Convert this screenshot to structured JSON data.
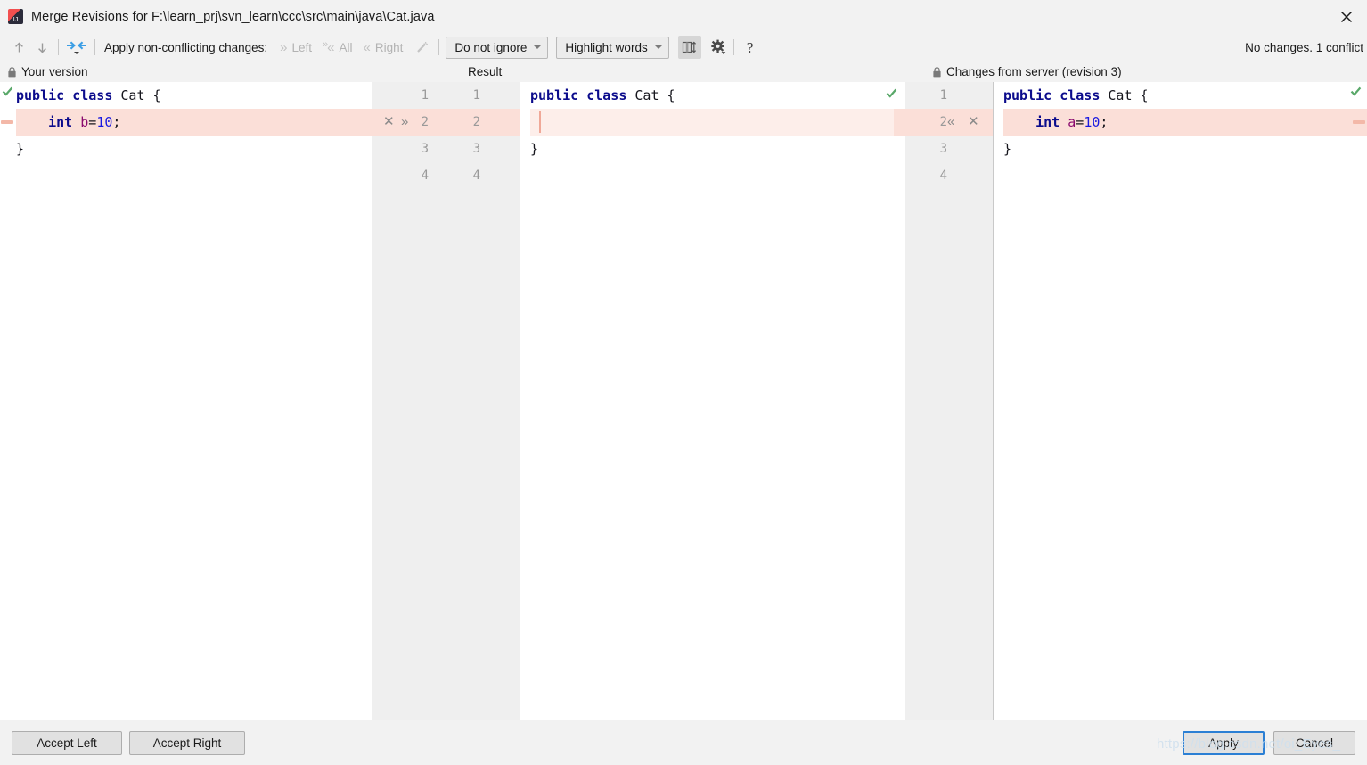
{
  "window": {
    "title": "Merge Revisions for F:\\learn_prj\\svn_learn\\ccc\\src\\main\\java\\Cat.java",
    "app_icon": "intellij-idea-icon",
    "close_label": "✕"
  },
  "toolbar": {
    "prev_icon": "arrow-up-icon",
    "next_icon": "arrow-down-icon",
    "merge_icon": "apply-both-arrows-icon",
    "apply_label": "Apply non-conflicting changes:",
    "apply_left": "Left",
    "apply_all": "All",
    "apply_right": "Right",
    "magic_icon": "magic-wand-icon",
    "ignore_policy": "Do not ignore",
    "highlight_policy": "Highlight words",
    "collapse_icon": "expand-collapse-icon",
    "settings_icon": "gear-icon",
    "help_icon": "?",
    "status": "No changes. 1 conflict"
  },
  "panels": {
    "left_title": "Your version",
    "center_title": "Result",
    "right_title": "Changes from server (revision 3)",
    "lock_icon": "lock-icon"
  },
  "code": {
    "left": [
      {
        "num": "1",
        "tokens": [
          {
            "t": "public",
            "c": "kw"
          },
          {
            "t": " ",
            "c": "pn"
          },
          {
            "t": "class",
            "c": "kw"
          },
          {
            "t": " ",
            "c": "pn"
          },
          {
            "t": "Cat",
            "c": "id"
          },
          {
            "t": " {",
            "c": "pn"
          }
        ],
        "hl": false
      },
      {
        "num": "2",
        "tokens": [
          {
            "t": "    ",
            "c": "pn"
          },
          {
            "t": "int",
            "c": "kw"
          },
          {
            "t": " ",
            "c": "pn"
          },
          {
            "t": "b",
            "c": "fld"
          },
          {
            "t": "=",
            "c": "pn"
          },
          {
            "t": "10",
            "c": "num"
          },
          {
            "t": ";",
            "c": "pn"
          }
        ],
        "hl": true
      },
      {
        "num": "3",
        "tokens": [
          {
            "t": "}",
            "c": "pn"
          }
        ],
        "hl": false
      },
      {
        "num": "4",
        "tokens": [],
        "hl": false
      }
    ],
    "result": [
      {
        "num": "1",
        "tokens": [
          {
            "t": "public",
            "c": "kw"
          },
          {
            "t": " ",
            "c": "pn"
          },
          {
            "t": "class",
            "c": "kw"
          },
          {
            "t": " ",
            "c": "pn"
          },
          {
            "t": "Cat",
            "c": "id"
          },
          {
            "t": " {",
            "c": "pn"
          }
        ],
        "hl": false
      },
      {
        "num": "2",
        "tokens": [],
        "hl": true
      },
      {
        "num": "3",
        "tokens": [
          {
            "t": "}",
            "c": "pn"
          }
        ],
        "hl": false
      },
      {
        "num": "4",
        "tokens": [],
        "hl": false
      }
    ],
    "right": [
      {
        "num": "1",
        "tokens": [
          {
            "t": "public",
            "c": "kw"
          },
          {
            "t": " ",
            "c": "pn"
          },
          {
            "t": "class",
            "c": "kw"
          },
          {
            "t": " ",
            "c": "pn"
          },
          {
            "t": "Cat",
            "c": "id"
          },
          {
            "t": " {",
            "c": "pn"
          }
        ],
        "hl": false
      },
      {
        "num": "2",
        "tokens": [
          {
            "t": "    ",
            "c": "pn"
          },
          {
            "t": "int",
            "c": "kw"
          },
          {
            "t": " ",
            "c": "pn"
          },
          {
            "t": "a",
            "c": "fld"
          },
          {
            "t": "=",
            "c": "pn"
          },
          {
            "t": "10",
            "c": "num"
          },
          {
            "t": ";",
            "c": "pn"
          }
        ],
        "hl": true
      },
      {
        "num": "3",
        "tokens": [
          {
            "t": "}",
            "c": "pn"
          }
        ],
        "hl": false
      },
      {
        "num": "4",
        "tokens": [],
        "hl": false
      }
    ]
  },
  "gutter": {
    "left_numbers_a": [
      "1",
      "2",
      "3",
      "4"
    ],
    "left_numbers_b": [
      "1",
      "2",
      "3",
      "4"
    ],
    "right_numbers": [
      "1",
      "2",
      "3",
      "4"
    ],
    "conflict_row_index": 1,
    "left_actions": {
      "revert": "✕",
      "accept": "»"
    },
    "right_actions": {
      "accept": "«",
      "revert": "✕"
    }
  },
  "buttons": {
    "accept_left": "Accept Left",
    "accept_right": "Accept Right",
    "apply": "Apply",
    "cancel": "Cancel"
  },
  "watermark": "https://blog.csdn.net/oi_Eyes_",
  "colors": {
    "conflict_bg": "#fbdfd8",
    "conflict_faint": "#fdeeea",
    "keyword": "#0b0b8c",
    "number": "#1a1ae0",
    "field": "#8a0b6e",
    "accent_focus": "#2b7fd4",
    "check_green": "#59a869",
    "window_bg": "#f2f2f2"
  }
}
